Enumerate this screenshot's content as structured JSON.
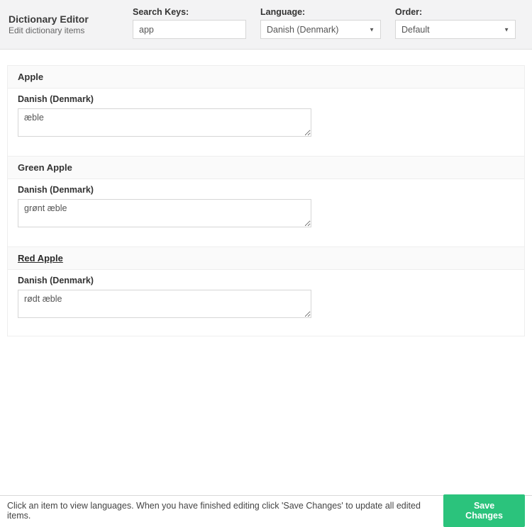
{
  "header": {
    "title": "Dictionary Editor",
    "subtitle": "Edit dictionary items",
    "filters": {
      "search": {
        "label": "Search Keys:",
        "value": "app"
      },
      "language": {
        "label": "Language:",
        "selected": "Danish (Denmark)"
      },
      "order": {
        "label": "Order:",
        "selected": "Default"
      }
    }
  },
  "items": [
    {
      "key": "Apple",
      "language": "Danish (Denmark)",
      "value": "æble",
      "emphasized": false
    },
    {
      "key": "Green Apple",
      "language": "Danish (Denmark)",
      "value": "grønt æble",
      "emphasized": false
    },
    {
      "key": "Red Apple",
      "language": "Danish (Denmark)",
      "value": "rødt æble",
      "emphasized": true
    }
  ],
  "footer": {
    "hint": "Click an item to view languages. When you have finished editing click 'Save Changes' to update all edited items.",
    "save_label": "Save Changes"
  }
}
